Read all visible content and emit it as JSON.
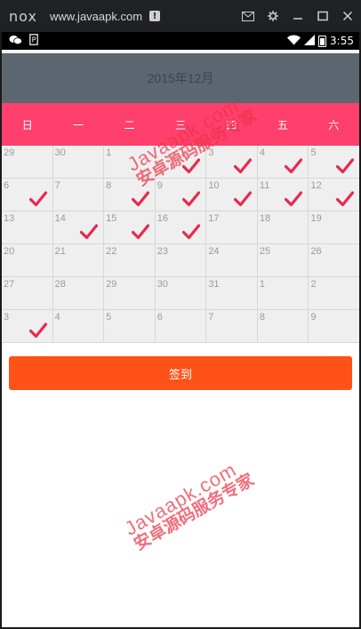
{
  "emulator": {
    "logo": "nox",
    "url": "www.javaapk.com",
    "warn_glyph": "!",
    "controls": [
      "mail-icon",
      "gear-icon",
      "minimize-icon",
      "maximize-icon",
      "close-icon"
    ]
  },
  "status_bar": {
    "time": "3:55",
    "left_icons": [
      "wechat-icon",
      "app-notification-icon"
    ],
    "right_icons": [
      "wifi-icon",
      "signal-icon",
      "battery-icon"
    ]
  },
  "calendar": {
    "title": "2015年12月",
    "weekdays": [
      "日",
      "一",
      "二",
      "三",
      "四",
      "五",
      "六"
    ],
    "rows": [
      [
        {
          "day": "29",
          "checked": false
        },
        {
          "day": "30",
          "checked": false
        },
        {
          "day": "1",
          "checked": false
        },
        {
          "day": "",
          "checked": true
        },
        {
          "day": "3",
          "checked": true
        },
        {
          "day": "4",
          "checked": true
        },
        {
          "day": "5",
          "checked": true
        }
      ],
      [
        {
          "day": "6",
          "checked": true
        },
        {
          "day": "7",
          "checked": false
        },
        {
          "day": "8",
          "checked": true
        },
        {
          "day": "9",
          "checked": true
        },
        {
          "day": "10",
          "checked": true
        },
        {
          "day": "11",
          "checked": true
        },
        {
          "day": "12",
          "checked": true
        }
      ],
      [
        {
          "day": "13",
          "checked": false
        },
        {
          "day": "14",
          "checked": true
        },
        {
          "day": "15",
          "checked": true
        },
        {
          "day": "16",
          "checked": true
        },
        {
          "day": "17",
          "checked": false
        },
        {
          "day": "18",
          "checked": false
        },
        {
          "day": "19",
          "checked": false
        }
      ],
      [
        {
          "day": "20",
          "checked": false
        },
        {
          "day": "21",
          "checked": false
        },
        {
          "day": "22",
          "checked": false
        },
        {
          "day": "23",
          "checked": false
        },
        {
          "day": "24",
          "checked": false
        },
        {
          "day": "25",
          "checked": false
        },
        {
          "day": "26",
          "checked": false
        }
      ],
      [
        {
          "day": "27",
          "checked": false
        },
        {
          "day": "28",
          "checked": false
        },
        {
          "day": "29",
          "checked": false
        },
        {
          "day": "30",
          "checked": false
        },
        {
          "day": "31",
          "checked": false
        },
        {
          "day": "1",
          "checked": false
        },
        {
          "day": "2",
          "checked": false
        }
      ],
      [
        {
          "day": "3",
          "checked": true
        },
        {
          "day": "4",
          "checked": false
        },
        {
          "day": "5",
          "checked": false
        },
        {
          "day": "6",
          "checked": false
        },
        {
          "day": "7",
          "checked": false
        },
        {
          "day": "8",
          "checked": false
        },
        {
          "day": "9",
          "checked": false
        }
      ]
    ]
  },
  "sign_button": {
    "label": "签到"
  },
  "watermark": {
    "line1": "Javaapk.com",
    "line2": "安卓源码服务专家"
  },
  "colors": {
    "title_bar": "#5c6670",
    "weekday_bar": "#ff3f6c",
    "button": "#ff5219",
    "check": "#e8294f",
    "watermark": "#ec3448"
  }
}
